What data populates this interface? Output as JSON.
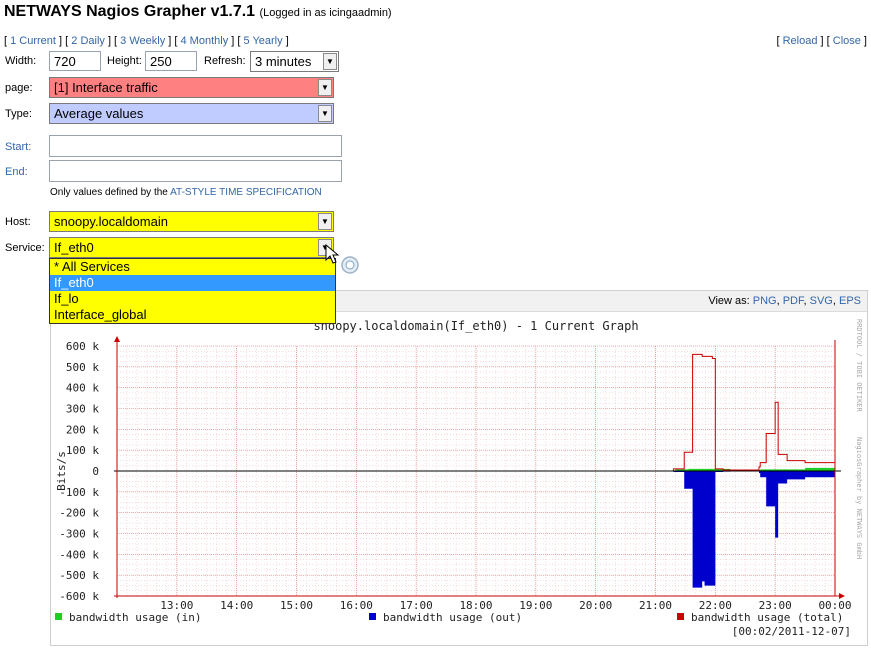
{
  "header": {
    "app_title": "NETWAYS Nagios Grapher v1.7.1",
    "login_status": "(Logged in as icingaadmin)"
  },
  "nav": {
    "timeframes": [
      "1 Current",
      "2 Daily",
      "3 Weekly",
      "4 Monthly",
      "5 Yearly"
    ],
    "reload": "Reload",
    "close": "Close"
  },
  "form": {
    "width_label": "Width:",
    "width_value": "720",
    "height_label": "Height:",
    "height_value": "250",
    "refresh_label": "Refresh:",
    "refresh_value": "3 minutes",
    "page_label": "page:",
    "page_value": "[1] Interface traffic",
    "type_label": "Type:",
    "type_value": "Average values",
    "start_label": "Start:",
    "start_value": "",
    "end_label": "End:",
    "end_value": "",
    "at_style_prefix": "Only values defined by the",
    "at_style_link": "AT-STYLE TIME SPECIFICATION",
    "host_label": "Host:",
    "host_value": "snoopy.localdomain",
    "service_label": "Service:",
    "service_value": "If_eth0",
    "service_options": [
      "* All Services",
      "If_eth0",
      "If_lo",
      "Interface_global"
    ],
    "service_selected_index": 1
  },
  "colors": {
    "page_select_bg": "#ff8080",
    "type_select_bg": "#c0ccff",
    "host_select_bg": "#ffff00",
    "selected_option_bg": "#3399ff",
    "series_in": "#22cc22",
    "series_out": "#0000cc",
    "series_total": "#cc0000"
  },
  "view_as": {
    "label": "View as:",
    "formats": [
      "PNG",
      "PDF",
      "SVG",
      "EPS"
    ]
  },
  "chart_data": {
    "type": "area",
    "title": "snoopy.localdomain(If_eth0) - 1 Current Graph",
    "ylabel": "Bits/s",
    "side_text": "RRDTOOL / TOBI OETIKER",
    "side_text2": "NagiosGrapher by NETWAYS GmbH",
    "x_ticks": [
      "13:00",
      "14:00",
      "15:00",
      "16:00",
      "17:00",
      "18:00",
      "19:00",
      "20:00",
      "21:00",
      "22:00",
      "23:00",
      "00:00"
    ],
    "y_ticks": [
      "600 k",
      "500 k",
      "400 k",
      "300 k",
      "200 k",
      "100 k",
      "0",
      "-100 k",
      "-200 k",
      "-300 k",
      "-400 k",
      "-500 k",
      "-600 k"
    ],
    "ylim": [
      -600000,
      600000
    ],
    "xlim_hours": [
      12.0,
      24.0
    ],
    "grid": true,
    "legend_position": "bottom",
    "legend": [
      "bandwidth usage (in)",
      "bandwidth usage (out)",
      "bandwidth usage (total)"
    ],
    "timestamp": "[00:02/2011-12-07]",
    "series": [
      {
        "name": "bandwidth usage (in)",
        "x": [
          21.13,
          21.33,
          21.55,
          22.0,
          22.25,
          22.75,
          23.5,
          24.0
        ],
        "y": [
          0,
          8000,
          10000,
          10000,
          5000,
          8000,
          15000,
          20000
        ]
      },
      {
        "name": "bandwidth usage (out)",
        "x": [
          21.13,
          21.3,
          21.45,
          21.48,
          21.58,
          21.62,
          21.66,
          21.78,
          21.82,
          21.95,
          22.0,
          22.13,
          22.25,
          22.55,
          22.73,
          22.75,
          22.85,
          22.9,
          23.0,
          23.05,
          23.1,
          23.2,
          23.5,
          24.0
        ],
        "y": [
          0,
          -5000,
          -5000,
          -85000,
          -85000,
          -560000,
          -560000,
          -530000,
          -550000,
          -550000,
          -5000,
          -3000,
          -2000,
          -2000,
          -10000,
          -30000,
          -170000,
          -170000,
          -320000,
          -60000,
          -60000,
          -40000,
          -30000,
          -30000
        ]
      },
      {
        "name": "bandwidth usage (total)",
        "x": [
          21.13,
          21.3,
          21.45,
          21.48,
          21.58,
          21.62,
          21.66,
          21.78,
          21.82,
          21.95,
          22.0,
          22.13,
          22.25,
          22.55,
          22.73,
          22.75,
          22.85,
          22.9,
          23.0,
          23.05,
          23.1,
          23.2,
          23.5,
          23.8,
          24.0
        ],
        "y": [
          0,
          10000,
          10000,
          90000,
          90000,
          560000,
          560000,
          550000,
          550000,
          540000,
          10000,
          5000,
          5000,
          5000,
          20000,
          40000,
          180000,
          180000,
          330000,
          80000,
          80000,
          50000,
          40000,
          40000,
          50000
        ]
      }
    ]
  }
}
